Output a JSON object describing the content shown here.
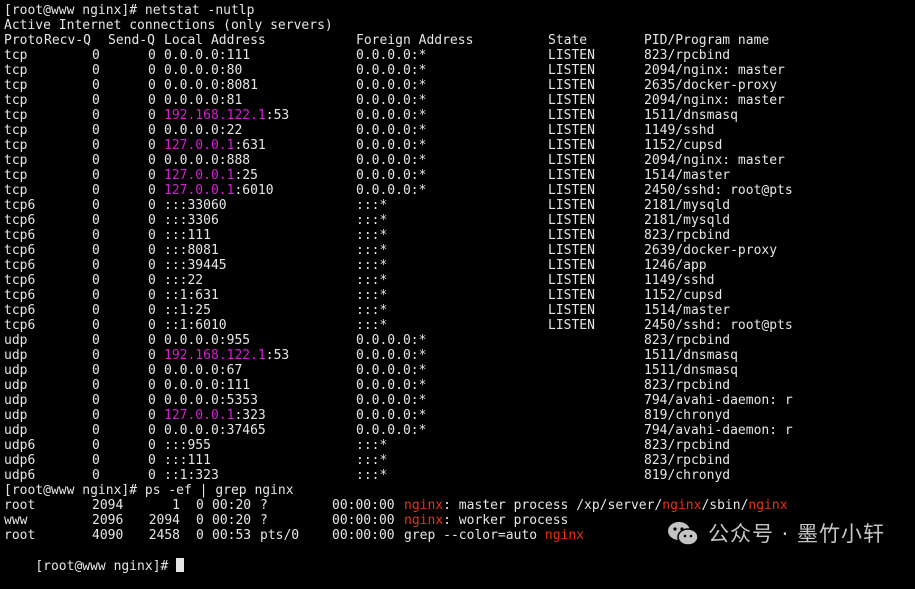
{
  "prompt1": "[root@www nginx]# netstat -nutlp",
  "subtitle": "Active Internet connections (only servers)",
  "netstat_headers": [
    "Proto",
    "Recv-Q",
    "Send-Q",
    "Local Address",
    "Foreign Address",
    "State",
    "PID/Program name"
  ],
  "netstat_rows": [
    {
      "proto": "tcp",
      "recvq": "0",
      "sendq": "0",
      "local_ip": "0.0.0.0",
      "local_port": ":111",
      "ip_hl": false,
      "foreign": "0.0.0.0:*",
      "state": "LISTEN",
      "pid": "823/rpcbind"
    },
    {
      "proto": "tcp",
      "recvq": "0",
      "sendq": "0",
      "local_ip": "0.0.0.0",
      "local_port": ":80",
      "ip_hl": false,
      "foreign": "0.0.0.0:*",
      "state": "LISTEN",
      "pid": "2094/nginx: master"
    },
    {
      "proto": "tcp",
      "recvq": "0",
      "sendq": "0",
      "local_ip": "0.0.0.0",
      "local_port": ":8081",
      "ip_hl": false,
      "foreign": "0.0.0.0:*",
      "state": "LISTEN",
      "pid": "2635/docker-proxy"
    },
    {
      "proto": "tcp",
      "recvq": "0",
      "sendq": "0",
      "local_ip": "0.0.0.0",
      "local_port": ":81",
      "ip_hl": false,
      "foreign": "0.0.0.0:*",
      "state": "LISTEN",
      "pid": "2094/nginx: master"
    },
    {
      "proto": "tcp",
      "recvq": "0",
      "sendq": "0",
      "local_ip": "192.168.122.1",
      "local_port": ":53",
      "ip_hl": true,
      "foreign": "0.0.0.0:*",
      "state": "LISTEN",
      "pid": "1511/dnsmasq"
    },
    {
      "proto": "tcp",
      "recvq": "0",
      "sendq": "0",
      "local_ip": "0.0.0.0",
      "local_port": ":22",
      "ip_hl": false,
      "foreign": "0.0.0.0:*",
      "state": "LISTEN",
      "pid": "1149/sshd"
    },
    {
      "proto": "tcp",
      "recvq": "0",
      "sendq": "0",
      "local_ip": "127.0.0.1",
      "local_port": ":631",
      "ip_hl": true,
      "foreign": "0.0.0.0:*",
      "state": "LISTEN",
      "pid": "1152/cupsd"
    },
    {
      "proto": "tcp",
      "recvq": "0",
      "sendq": "0",
      "local_ip": "0.0.0.0",
      "local_port": ":888",
      "ip_hl": false,
      "foreign": "0.0.0.0:*",
      "state": "LISTEN",
      "pid": "2094/nginx: master"
    },
    {
      "proto": "tcp",
      "recvq": "0",
      "sendq": "0",
      "local_ip": "127.0.0.1",
      "local_port": ":25",
      "ip_hl": true,
      "foreign": "0.0.0.0:*",
      "state": "LISTEN",
      "pid": "1514/master"
    },
    {
      "proto": "tcp",
      "recvq": "0",
      "sendq": "0",
      "local_ip": "127.0.0.1",
      "local_port": ":6010",
      "ip_hl": true,
      "foreign": "0.0.0.0:*",
      "state": "LISTEN",
      "pid": "2450/sshd: root@pts"
    },
    {
      "proto": "tcp6",
      "recvq": "0",
      "sendq": "0",
      "local_ip": ":::33060",
      "local_port": "",
      "ip_hl": false,
      "foreign": ":::*",
      "state": "LISTEN",
      "pid": "2181/mysqld"
    },
    {
      "proto": "tcp6",
      "recvq": "0",
      "sendq": "0",
      "local_ip": ":::3306",
      "local_port": "",
      "ip_hl": false,
      "foreign": ":::*",
      "state": "LISTEN",
      "pid": "2181/mysqld"
    },
    {
      "proto": "tcp6",
      "recvq": "0",
      "sendq": "0",
      "local_ip": ":::111",
      "local_port": "",
      "ip_hl": false,
      "foreign": ":::*",
      "state": "LISTEN",
      "pid": "823/rpcbind"
    },
    {
      "proto": "tcp6",
      "recvq": "0",
      "sendq": "0",
      "local_ip": ":::8081",
      "local_port": "",
      "ip_hl": false,
      "foreign": ":::*",
      "state": "LISTEN",
      "pid": "2639/docker-proxy"
    },
    {
      "proto": "tcp6",
      "recvq": "0",
      "sendq": "0",
      "local_ip": ":::39445",
      "local_port": "",
      "ip_hl": false,
      "foreign": ":::*",
      "state": "LISTEN",
      "pid": "1246/app"
    },
    {
      "proto": "tcp6",
      "recvq": "0",
      "sendq": "0",
      "local_ip": ":::22",
      "local_port": "",
      "ip_hl": false,
      "foreign": ":::*",
      "state": "LISTEN",
      "pid": "1149/sshd"
    },
    {
      "proto": "tcp6",
      "recvq": "0",
      "sendq": "0",
      "local_ip": "::1:631",
      "local_port": "",
      "ip_hl": false,
      "foreign": ":::*",
      "state": "LISTEN",
      "pid": "1152/cupsd"
    },
    {
      "proto": "tcp6",
      "recvq": "0",
      "sendq": "0",
      "local_ip": "::1:25",
      "local_port": "",
      "ip_hl": false,
      "foreign": ":::*",
      "state": "LISTEN",
      "pid": "1514/master"
    },
    {
      "proto": "tcp6",
      "recvq": "0",
      "sendq": "0",
      "local_ip": "::1:6010",
      "local_port": "",
      "ip_hl": false,
      "foreign": ":::*",
      "state": "LISTEN",
      "pid": "2450/sshd: root@pts"
    },
    {
      "proto": "udp",
      "recvq": "0",
      "sendq": "0",
      "local_ip": "0.0.0.0",
      "local_port": ":955",
      "ip_hl": false,
      "foreign": "0.0.0.0:*",
      "state": "",
      "pid": "823/rpcbind"
    },
    {
      "proto": "udp",
      "recvq": "0",
      "sendq": "0",
      "local_ip": "192.168.122.1",
      "local_port": ":53",
      "ip_hl": true,
      "foreign": "0.0.0.0:*",
      "state": "",
      "pid": "1511/dnsmasq"
    },
    {
      "proto": "udp",
      "recvq": "0",
      "sendq": "0",
      "local_ip": "0.0.0.0",
      "local_port": ":67",
      "ip_hl": false,
      "foreign": "0.0.0.0:*",
      "state": "",
      "pid": "1511/dnsmasq"
    },
    {
      "proto": "udp",
      "recvq": "0",
      "sendq": "0",
      "local_ip": "0.0.0.0",
      "local_port": ":111",
      "ip_hl": false,
      "foreign": "0.0.0.0:*",
      "state": "",
      "pid": "823/rpcbind"
    },
    {
      "proto": "udp",
      "recvq": "0",
      "sendq": "0",
      "local_ip": "0.0.0.0",
      "local_port": ":5353",
      "ip_hl": false,
      "foreign": "0.0.0.0:*",
      "state": "",
      "pid": "794/avahi-daemon: r"
    },
    {
      "proto": "udp",
      "recvq": "0",
      "sendq": "0",
      "local_ip": "127.0.0.1",
      "local_port": ":323",
      "ip_hl": true,
      "foreign": "0.0.0.0:*",
      "state": "",
      "pid": "819/chronyd"
    },
    {
      "proto": "udp",
      "recvq": "0",
      "sendq": "0",
      "local_ip": "0.0.0.0",
      "local_port": ":37465",
      "ip_hl": false,
      "foreign": "0.0.0.0:*",
      "state": "",
      "pid": "794/avahi-daemon: r"
    },
    {
      "proto": "udp6",
      "recvq": "0",
      "sendq": "0",
      "local_ip": ":::955",
      "local_port": "",
      "ip_hl": false,
      "foreign": ":::*",
      "state": "",
      "pid": "823/rpcbind"
    },
    {
      "proto": "udp6",
      "recvq": "0",
      "sendq": "0",
      "local_ip": ":::111",
      "local_port": "",
      "ip_hl": false,
      "foreign": ":::*",
      "state": "",
      "pid": "823/rpcbind"
    },
    {
      "proto": "udp6",
      "recvq": "0",
      "sendq": "0",
      "local_ip": "::1:323",
      "local_port": "",
      "ip_hl": false,
      "foreign": ":::*",
      "state": "",
      "pid": "819/chronyd"
    }
  ],
  "prompt2": "[root@www nginx]# ps -ef | grep nginx",
  "ps_rows": [
    {
      "user": "root",
      "pid": "2094",
      "ppid": "1",
      "c": "0",
      "stime": "00:20",
      "tty": "?",
      "time": "00:00:00",
      "cmd": [
        {
          "t": "nginx",
          "hl": true
        },
        {
          "t": ": master process /xp/server/",
          "hl": false
        },
        {
          "t": "nginx",
          "hl": true
        },
        {
          "t": "/sbin/",
          "hl": false
        },
        {
          "t": "nginx",
          "hl": true
        }
      ]
    },
    {
      "user": "www",
      "pid": "2096",
      "ppid": "2094",
      "c": "0",
      "stime": "00:20",
      "tty": "?",
      "time": "00:00:00",
      "cmd": [
        {
          "t": "nginx",
          "hl": true
        },
        {
          "t": ": worker process",
          "hl": false
        }
      ]
    },
    {
      "user": "root",
      "pid": "4090",
      "ppid": "2458",
      "c": "0",
      "stime": "00:53",
      "tty": "pts/0",
      "time": "00:00:00",
      "cmd": [
        {
          "t": "grep --color=auto ",
          "hl": false
        },
        {
          "t": "nginx",
          "hl": true
        }
      ]
    }
  ],
  "prompt3": "[root@www nginx]# ",
  "watermark": "公众号 · 墨竹小轩",
  "colors": {
    "background": "#000000",
    "text": "#e6e6e6",
    "ip_highlight": "#d61fd6",
    "grep_highlight": "#e8320f"
  }
}
